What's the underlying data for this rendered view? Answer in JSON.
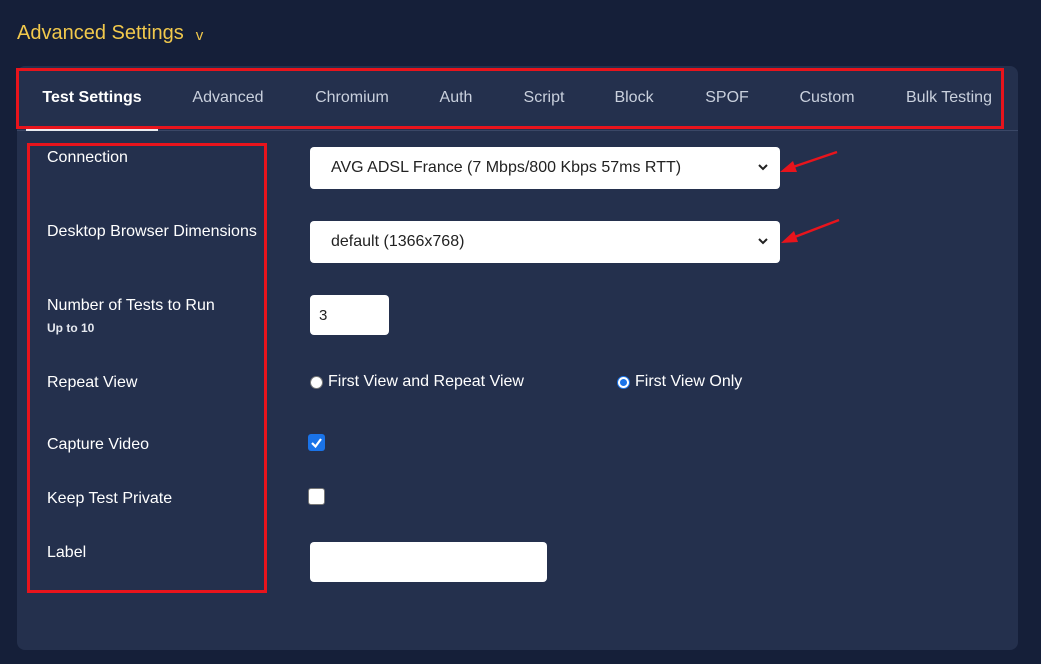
{
  "section": {
    "title": "Advanced Settings",
    "toggle_icon": "chevron-down-icon",
    "color": "#f2c94c"
  },
  "tabs": [
    {
      "label": "Test Settings",
      "active": true
    },
    {
      "label": "Advanced",
      "active": false
    },
    {
      "label": "Chromium",
      "active": false
    },
    {
      "label": "Auth",
      "active": false
    },
    {
      "label": "Script",
      "active": false
    },
    {
      "label": "Block",
      "active": false
    },
    {
      "label": "SPOF",
      "active": false
    },
    {
      "label": "Custom",
      "active": false
    },
    {
      "label": "Bulk Testing",
      "active": false
    }
  ],
  "form": {
    "connection": {
      "label": "Connection",
      "value": "AVG ADSL France (7 Mbps/800 Kbps 57ms RTT)"
    },
    "dimensions": {
      "label": "Desktop Browser Dimensions",
      "value": "default (1366x768)"
    },
    "num_tests": {
      "label": "Number of Tests to Run",
      "hint": "Up to 10",
      "value": "3"
    },
    "repeat_view": {
      "label": "Repeat View",
      "options": [
        {
          "label": "First View and Repeat View",
          "checked": false
        },
        {
          "label": "First View Only",
          "checked": true
        }
      ]
    },
    "capture_video": {
      "label": "Capture Video",
      "checked": true
    },
    "keep_private": {
      "label": "Keep Test Private",
      "checked": false
    },
    "test_label": {
      "label": "Label",
      "value": ""
    }
  },
  "annotation_color": "#e8141c"
}
